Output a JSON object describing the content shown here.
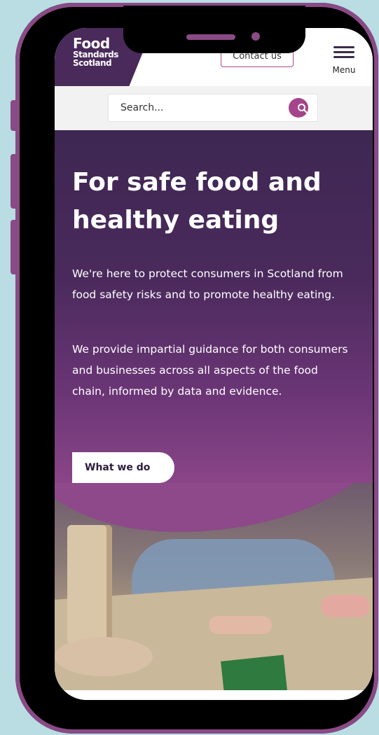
{
  "header": {
    "logo": {
      "line1": "Food",
      "line2": "Standards",
      "line3": "Scotland"
    },
    "contact_label": "Contact us",
    "menu_label": "Menu"
  },
  "search": {
    "placeholder": "Search..."
  },
  "hero": {
    "title": "For safe food and healthy eating",
    "paragraph1": "We're here to protect consumers in Scotland from food safety risks and to promote healthy eating.",
    "paragraph2": "We provide impartial guidance for both consumers and businesses across all aspects of the food chain, informed by data and evidence.",
    "cta_label": "What we do"
  },
  "colors": {
    "brand_purple": "#4a2a5a",
    "accent_magenta": "#a5448a",
    "phone_frame": "#8a4a86",
    "background": "#b9dde3"
  },
  "icons": [
    "search-icon",
    "hamburger-menu-icon"
  ]
}
